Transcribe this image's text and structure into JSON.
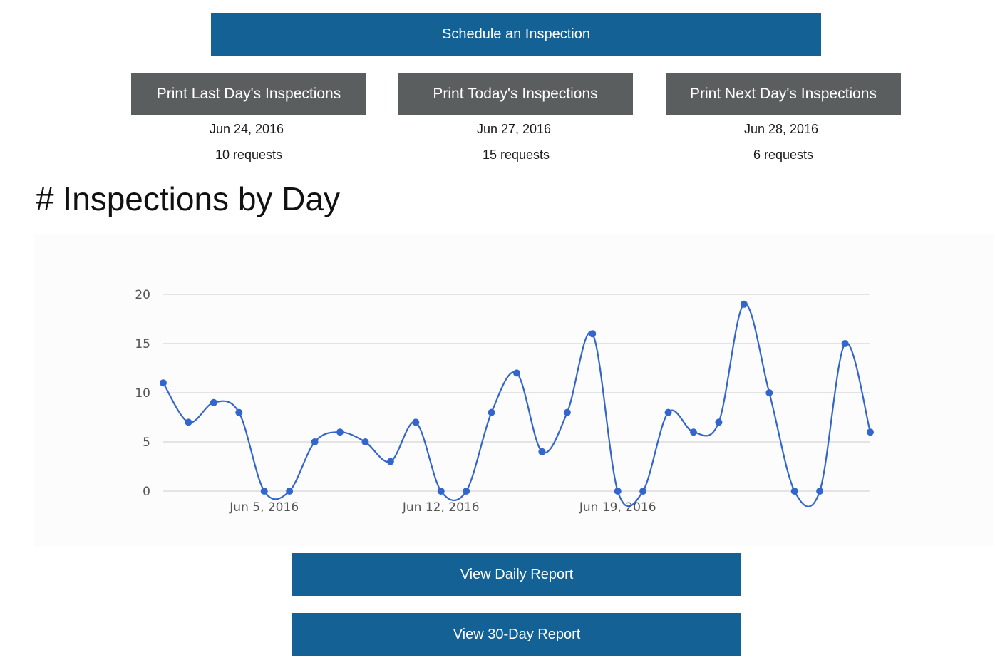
{
  "schedule_button": {
    "label": "Schedule an Inspection"
  },
  "print_cards": [
    {
      "label": "Print Last Day's Inspections",
      "date": "Jun 24, 2016",
      "requests": "10 requests"
    },
    {
      "label": "Print Today's Inspections",
      "date": "Jun 27, 2016",
      "requests": "15 requests"
    },
    {
      "label": "Print Next Day's Inspections",
      "date": "Jun 28, 2016",
      "requests": "6 requests"
    }
  ],
  "section_title": "# Inspections by Day",
  "reports": {
    "daily_label": "View Daily Report",
    "thirty_day_label": "View 30-Day Report"
  },
  "colors": {
    "primary_button": "#146295",
    "secondary_button": "#5a5e5e",
    "series_line": "#3366cc"
  },
  "chart_data": {
    "type": "line",
    "x_start": "Jun 1, 2016",
    "x": [
      "2016-06-01",
      "2016-06-02",
      "2016-06-03",
      "2016-06-04",
      "2016-06-05",
      "2016-06-06",
      "2016-06-07",
      "2016-06-08",
      "2016-06-09",
      "2016-06-10",
      "2016-06-11",
      "2016-06-12",
      "2016-06-13",
      "2016-06-14",
      "2016-06-15",
      "2016-06-16",
      "2016-06-17",
      "2016-06-18",
      "2016-06-19",
      "2016-06-20",
      "2016-06-21",
      "2016-06-22",
      "2016-06-23",
      "2016-06-24",
      "2016-06-25",
      "2016-06-26",
      "2016-06-27",
      "2016-06-28",
      "2016-06-29"
    ],
    "values": [
      11,
      7,
      9,
      8,
      0,
      0,
      5,
      6,
      5,
      3,
      7,
      0,
      0,
      8,
      12,
      4,
      8,
      16,
      0,
      0,
      8,
      6,
      7,
      19,
      10,
      0,
      0,
      15,
      6
    ],
    "ylim": [
      0,
      20
    ],
    "y_ticks": [
      "0",
      "5",
      "10",
      "15",
      "20"
    ],
    "x_tick_labels": [
      "Jun 5, 2016",
      "Jun 12, 2016",
      "Jun 19, 2016"
    ],
    "smooth": true,
    "grid": true
  }
}
